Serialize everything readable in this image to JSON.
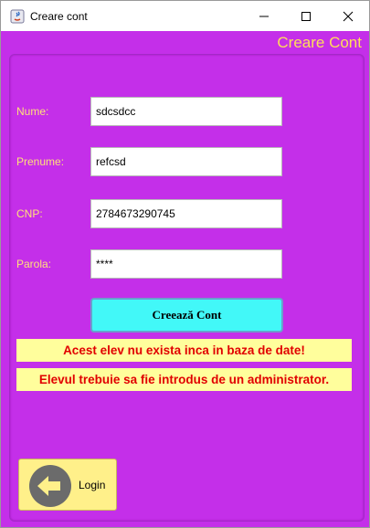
{
  "window": {
    "title": "Creare cont",
    "controls": {
      "minimize": "minimize",
      "maximize": "maximize",
      "close": "close"
    }
  },
  "header": {
    "title": "Creare Cont"
  },
  "form": {
    "nume": {
      "label": "Nume:",
      "value": "sdcsdcc"
    },
    "prenume": {
      "label": "Prenume:",
      "value": "refcsd"
    },
    "cnp": {
      "label": "CNP:",
      "value": "2784673290745"
    },
    "parola": {
      "label": "Parola:",
      "value": "****"
    }
  },
  "actions": {
    "create_label": "Creează Cont"
  },
  "messages": {
    "line1": "Acest elev nu exista inca in baza de date!",
    "line2": "Elevul trebuie sa fie introdus de un administrator."
  },
  "login": {
    "label": "Login",
    "icon": "back-arrow-icon"
  },
  "colors": {
    "background": "#c42fe9",
    "label": "#ffe07a",
    "header": "#ffde59",
    "button": "#42f8f8",
    "message_bg": "#fffe9c",
    "message_text": "#e10000",
    "login_bg": "#fff08a"
  }
}
